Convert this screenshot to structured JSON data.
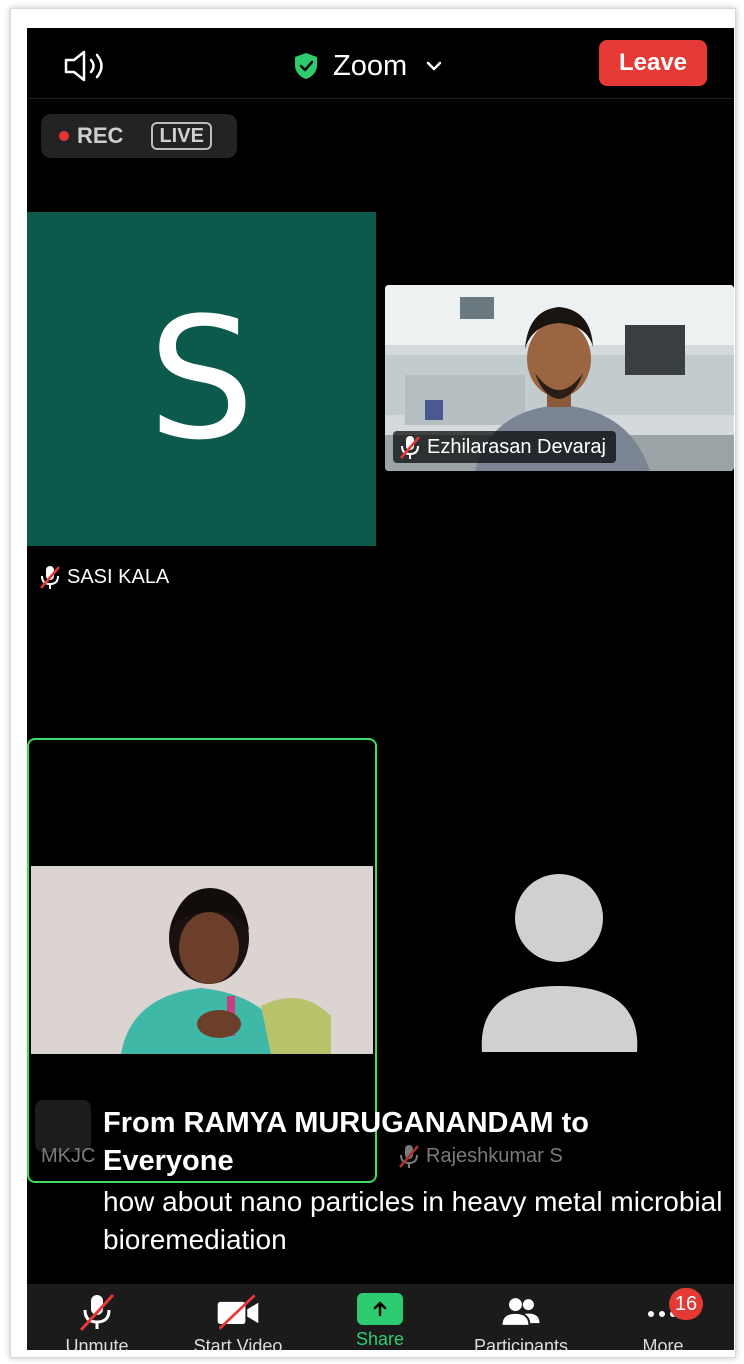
{
  "header": {
    "title": "Zoom",
    "leave_label": "Leave",
    "rec_label": "REC",
    "live_label": "LIVE"
  },
  "tiles": {
    "sasi": {
      "initial": "S",
      "name": "SASI KALA",
      "bg_color": "#0c5a4b"
    },
    "ezhil": {
      "name": "Ezhilarasan Devaraj"
    },
    "ramya": {
      "label": "MKJC"
    },
    "rajesh": {
      "name": "Rajeshkumar S"
    }
  },
  "chat": {
    "from": "From RAMYA MURUGANANDAM to Everyone",
    "message": "how about nano particles in heavy metal microbial bioremediation"
  },
  "toolbar": {
    "unmute": "Unmute",
    "start_video": "Start Video",
    "share": "Share",
    "participants": "Participants",
    "more": "More",
    "more_badge": "16"
  },
  "colors": {
    "accent_green": "#2ecc71",
    "leave_red": "#e53935",
    "active_speaker": "#3ddc64"
  },
  "icons": [
    "speaker-icon",
    "shield-check-icon",
    "chevron-down-icon",
    "mic-muted-icon",
    "video-off-icon",
    "share-up-arrow-icon",
    "participants-icon",
    "more-dots-icon",
    "avatar-placeholder-icon"
  ]
}
